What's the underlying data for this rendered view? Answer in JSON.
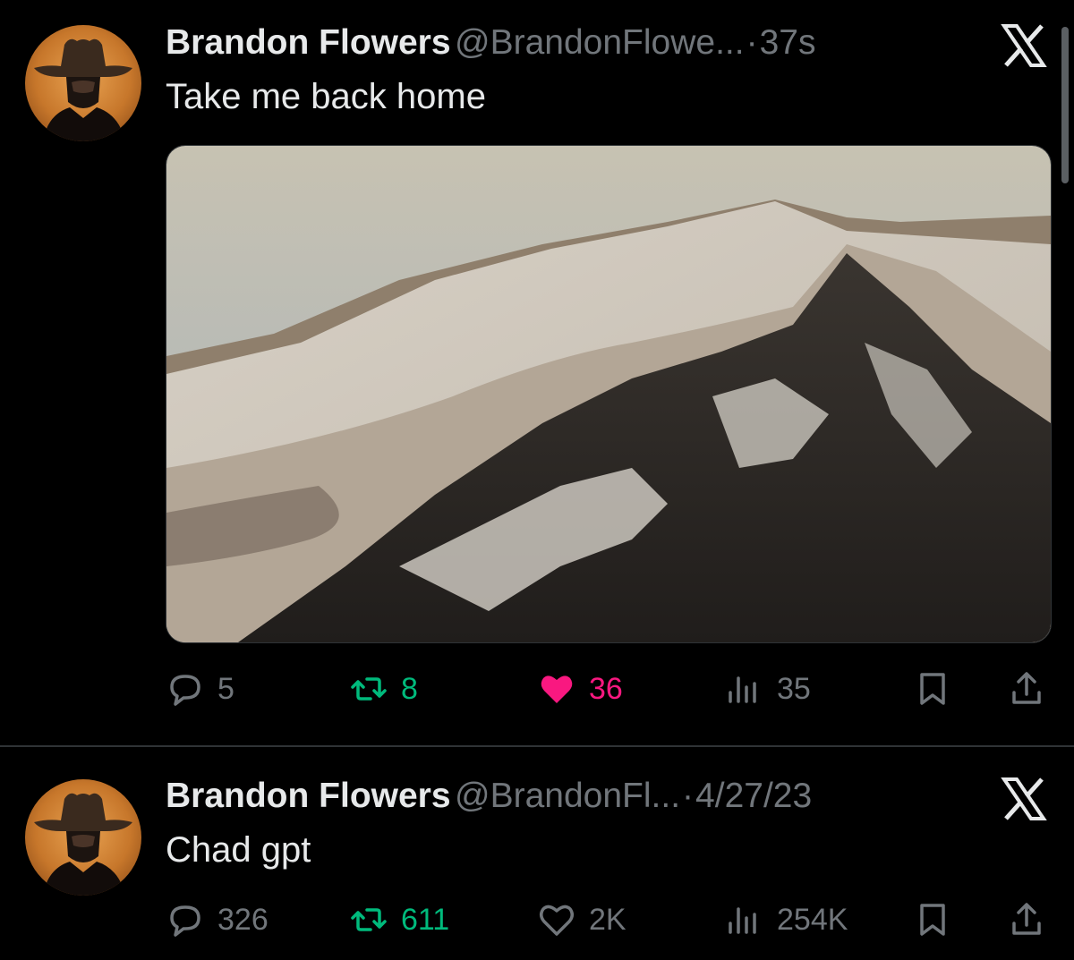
{
  "tweets": [
    {
      "author_name": "Brandon Flowers",
      "handle": "@BrandonFlowe...",
      "separator": "·",
      "time": "37s",
      "text": "Take me back home",
      "has_media": true,
      "stats": {
        "replies": "5",
        "reposts": "8",
        "likes": "36",
        "views": "35"
      },
      "liked": true
    },
    {
      "author_name": "Brandon Flowers",
      "handle": "@BrandonFl...",
      "separator": "·",
      "time": "4/27/23",
      "text": "Chad gpt",
      "has_media": false,
      "stats": {
        "replies": "326",
        "reposts": "611",
        "likes": "2K",
        "views": "254K"
      },
      "liked": false
    }
  ],
  "icons": [
    "reply-icon",
    "repost-icon",
    "like-icon",
    "views-icon",
    "bookmark-icon",
    "share-icon",
    "x-logo-icon",
    "avatar"
  ],
  "colors": {
    "background": "#000000",
    "text": "#e7e9ea",
    "muted": "#71767b",
    "repost": "#00ba7c",
    "like": "#f91880"
  }
}
